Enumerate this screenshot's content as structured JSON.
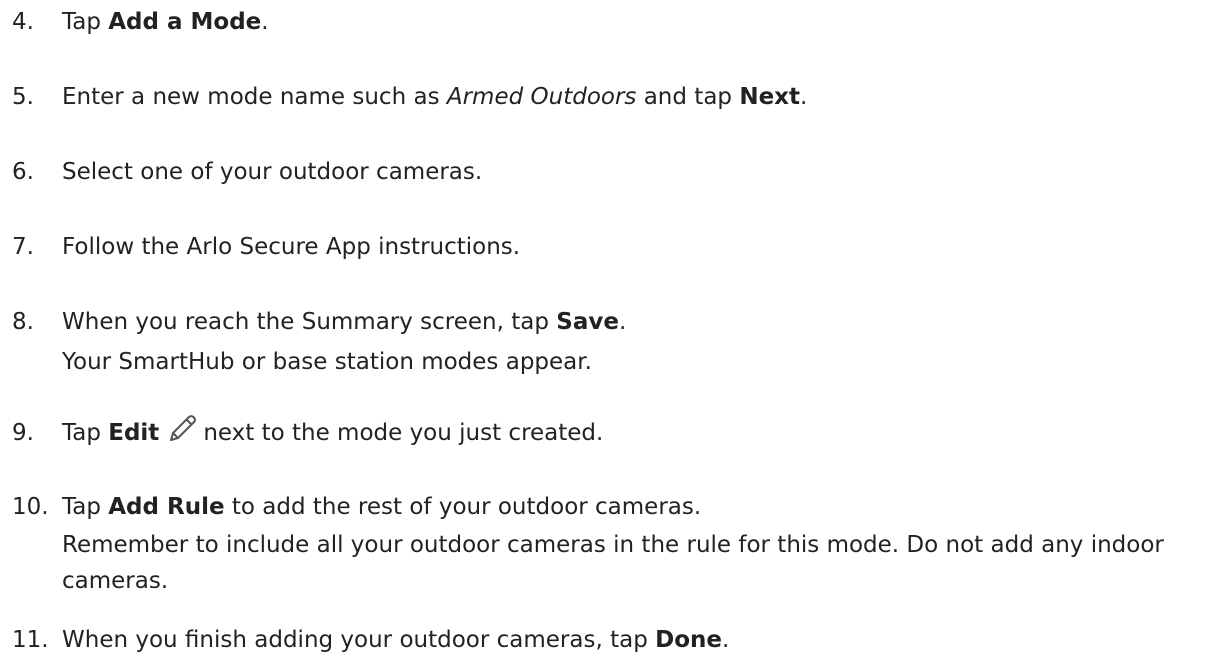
{
  "steps": [
    {
      "number": "4.",
      "parts": [
        {
          "t": "Tap ",
          "s": ""
        },
        {
          "t": "Add a Mode",
          "s": "b"
        },
        {
          "t": ".",
          "s": ""
        }
      ]
    },
    {
      "number": "5.",
      "parts": [
        {
          "t": "Enter a new mode name such as ",
          "s": ""
        },
        {
          "t": "Armed Outdoors",
          "s": "i"
        },
        {
          "t": " and tap ",
          "s": ""
        },
        {
          "t": "Next",
          "s": "b"
        },
        {
          "t": ".",
          "s": ""
        }
      ]
    },
    {
      "number": "6.",
      "parts": [
        {
          "t": "Select one of your outdoor cameras.",
          "s": ""
        }
      ]
    },
    {
      "number": "7.",
      "parts": [
        {
          "t": "Follow the Arlo Secure App instructions.",
          "s": ""
        }
      ]
    },
    {
      "number": "8.",
      "parts": [
        {
          "t": "When you reach the Summary screen, tap ",
          "s": ""
        },
        {
          "t": "Save",
          "s": "b"
        },
        {
          "t": ".",
          "s": ""
        }
      ],
      "sub": "Your SmartHub or base station modes appear."
    },
    {
      "number": "9.",
      "parts": [
        {
          "t": "Tap ",
          "s": ""
        },
        {
          "t": "Edit",
          "s": "b"
        },
        {
          "t": "",
          "s": "icon"
        },
        {
          "t": "next to the mode you just created.",
          "s": ""
        }
      ],
      "icon": "pencil-icon"
    },
    {
      "number": "10.",
      "parts": [
        {
          "t": "Tap ",
          "s": ""
        },
        {
          "t": "Add Rule",
          "s": "b"
        },
        {
          "t": " to add the rest of your outdoor cameras.",
          "s": ""
        }
      ],
      "sub": "Remember to include all your outdoor cameras in the rule for this mode. Do not add any indoor cameras."
    },
    {
      "number": "11.",
      "parts": [
        {
          "t": "When you finish adding your outdoor cameras, tap ",
          "s": ""
        },
        {
          "t": "Done",
          "s": "b"
        },
        {
          "t": ".",
          "s": ""
        }
      ]
    }
  ],
  "colors": {
    "text": "#222222",
    "icon_stroke": "#555555"
  }
}
